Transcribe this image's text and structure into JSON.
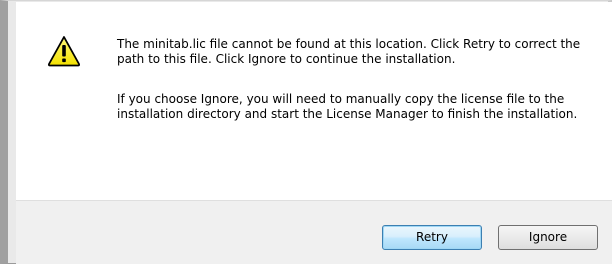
{
  "dialog": {
    "icon": "warning-triangle-icon",
    "message_primary": "The minitab.lic file cannot be found at this location. Click Retry to correct the path to this file. Click Ignore to continue the installation.",
    "message_secondary": "If you choose Ignore, you will need to manually copy the license file to the installation directory and start the License Manager to finish the installation.",
    "buttons": {
      "retry": "Retry",
      "ignore": "Ignore"
    },
    "colors": {
      "warning_fill": "#f3e100",
      "warning_stroke": "#000000",
      "default_button_border": "#3c7fb1"
    }
  }
}
